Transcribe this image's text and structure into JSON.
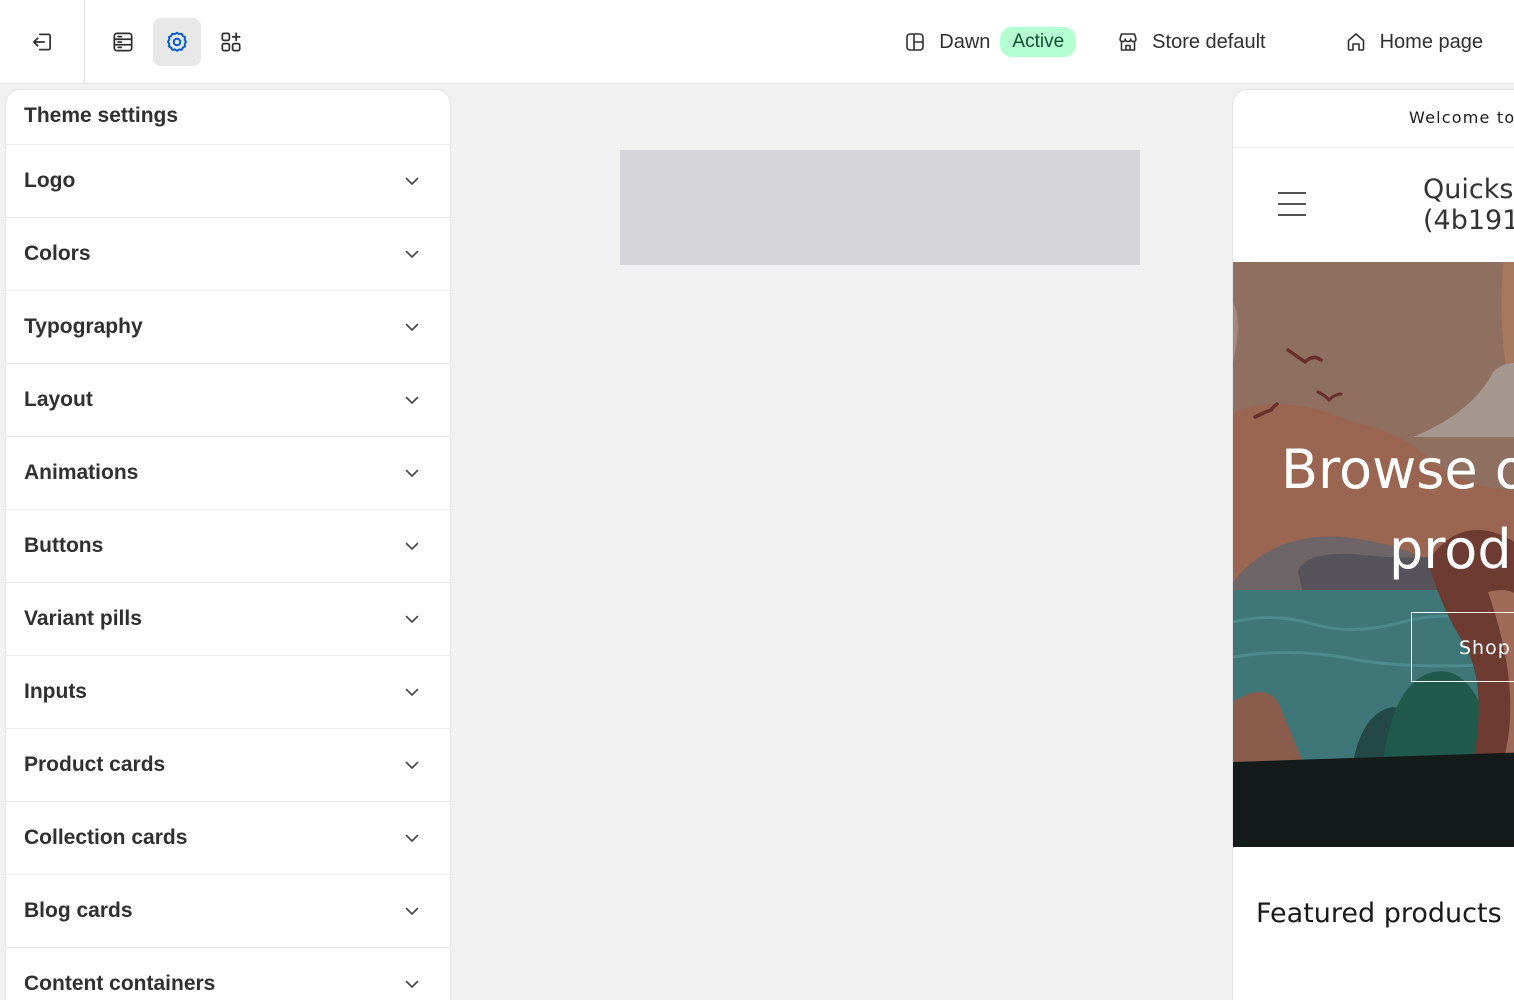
{
  "topbar": {
    "exit_icon": "exit-icon",
    "tools": [
      {
        "name": "sections-icon",
        "active": false
      },
      {
        "name": "theme-settings-gear-icon",
        "active": true
      },
      {
        "name": "app-embeds-icon",
        "active": false
      }
    ],
    "theme_name": "Dawn",
    "theme_status": "Active",
    "store_context": "Store default",
    "page_selector": "Home page"
  },
  "sidebar": {
    "title": "Theme settings",
    "items": [
      {
        "label": "Logo"
      },
      {
        "label": "Colors"
      },
      {
        "label": "Typography"
      },
      {
        "label": "Layout"
      },
      {
        "label": "Animations"
      },
      {
        "label": "Buttons"
      },
      {
        "label": "Variant pills"
      },
      {
        "label": "Inputs"
      },
      {
        "label": "Product cards"
      },
      {
        "label": "Collection cards"
      },
      {
        "label": "Blog cards"
      },
      {
        "label": "Content containers"
      }
    ]
  },
  "preview": {
    "announcement": "Welcome to",
    "store_name_line1": "Quicks",
    "store_name_line2": "(4b191(",
    "hero_title_line1": "Browse o",
    "hero_title_line2": "prod",
    "hero_button": "Shop",
    "featured_heading": "Featured products"
  },
  "colors": {
    "accent": "#005bd3",
    "active_badge_bg": "#b4fed2",
    "active_badge_text": "#0c5132"
  }
}
